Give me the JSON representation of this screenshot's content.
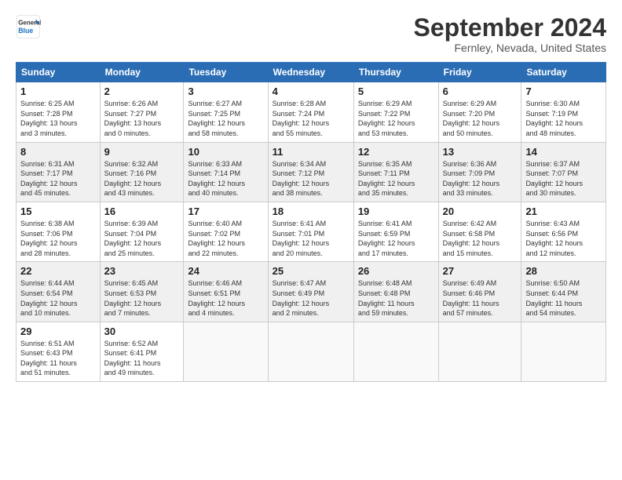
{
  "header": {
    "logo_line1": "General",
    "logo_line2": "Blue",
    "month": "September 2024",
    "location": "Fernley, Nevada, United States"
  },
  "weekdays": [
    "Sunday",
    "Monday",
    "Tuesday",
    "Wednesday",
    "Thursday",
    "Friday",
    "Saturday"
  ],
  "weeks": [
    [
      {
        "day": "1",
        "info": "Sunrise: 6:25 AM\nSunset: 7:28 PM\nDaylight: 13 hours\nand 3 minutes."
      },
      {
        "day": "2",
        "info": "Sunrise: 6:26 AM\nSunset: 7:27 PM\nDaylight: 13 hours\nand 0 minutes."
      },
      {
        "day": "3",
        "info": "Sunrise: 6:27 AM\nSunset: 7:25 PM\nDaylight: 12 hours\nand 58 minutes."
      },
      {
        "day": "4",
        "info": "Sunrise: 6:28 AM\nSunset: 7:24 PM\nDaylight: 12 hours\nand 55 minutes."
      },
      {
        "day": "5",
        "info": "Sunrise: 6:29 AM\nSunset: 7:22 PM\nDaylight: 12 hours\nand 53 minutes."
      },
      {
        "day": "6",
        "info": "Sunrise: 6:29 AM\nSunset: 7:20 PM\nDaylight: 12 hours\nand 50 minutes."
      },
      {
        "day": "7",
        "info": "Sunrise: 6:30 AM\nSunset: 7:19 PM\nDaylight: 12 hours\nand 48 minutes."
      }
    ],
    [
      {
        "day": "8",
        "info": "Sunrise: 6:31 AM\nSunset: 7:17 PM\nDaylight: 12 hours\nand 45 minutes."
      },
      {
        "day": "9",
        "info": "Sunrise: 6:32 AM\nSunset: 7:16 PM\nDaylight: 12 hours\nand 43 minutes."
      },
      {
        "day": "10",
        "info": "Sunrise: 6:33 AM\nSunset: 7:14 PM\nDaylight: 12 hours\nand 40 minutes."
      },
      {
        "day": "11",
        "info": "Sunrise: 6:34 AM\nSunset: 7:12 PM\nDaylight: 12 hours\nand 38 minutes."
      },
      {
        "day": "12",
        "info": "Sunrise: 6:35 AM\nSunset: 7:11 PM\nDaylight: 12 hours\nand 35 minutes."
      },
      {
        "day": "13",
        "info": "Sunrise: 6:36 AM\nSunset: 7:09 PM\nDaylight: 12 hours\nand 33 minutes."
      },
      {
        "day": "14",
        "info": "Sunrise: 6:37 AM\nSunset: 7:07 PM\nDaylight: 12 hours\nand 30 minutes."
      }
    ],
    [
      {
        "day": "15",
        "info": "Sunrise: 6:38 AM\nSunset: 7:06 PM\nDaylight: 12 hours\nand 28 minutes."
      },
      {
        "day": "16",
        "info": "Sunrise: 6:39 AM\nSunset: 7:04 PM\nDaylight: 12 hours\nand 25 minutes."
      },
      {
        "day": "17",
        "info": "Sunrise: 6:40 AM\nSunset: 7:02 PM\nDaylight: 12 hours\nand 22 minutes."
      },
      {
        "day": "18",
        "info": "Sunrise: 6:41 AM\nSunset: 7:01 PM\nDaylight: 12 hours\nand 20 minutes."
      },
      {
        "day": "19",
        "info": "Sunrise: 6:41 AM\nSunset: 6:59 PM\nDaylight: 12 hours\nand 17 minutes."
      },
      {
        "day": "20",
        "info": "Sunrise: 6:42 AM\nSunset: 6:58 PM\nDaylight: 12 hours\nand 15 minutes."
      },
      {
        "day": "21",
        "info": "Sunrise: 6:43 AM\nSunset: 6:56 PM\nDaylight: 12 hours\nand 12 minutes."
      }
    ],
    [
      {
        "day": "22",
        "info": "Sunrise: 6:44 AM\nSunset: 6:54 PM\nDaylight: 12 hours\nand 10 minutes."
      },
      {
        "day": "23",
        "info": "Sunrise: 6:45 AM\nSunset: 6:53 PM\nDaylight: 12 hours\nand 7 minutes."
      },
      {
        "day": "24",
        "info": "Sunrise: 6:46 AM\nSunset: 6:51 PM\nDaylight: 12 hours\nand 4 minutes."
      },
      {
        "day": "25",
        "info": "Sunrise: 6:47 AM\nSunset: 6:49 PM\nDaylight: 12 hours\nand 2 minutes."
      },
      {
        "day": "26",
        "info": "Sunrise: 6:48 AM\nSunset: 6:48 PM\nDaylight: 11 hours\nand 59 minutes."
      },
      {
        "day": "27",
        "info": "Sunrise: 6:49 AM\nSunset: 6:46 PM\nDaylight: 11 hours\nand 57 minutes."
      },
      {
        "day": "28",
        "info": "Sunrise: 6:50 AM\nSunset: 6:44 PM\nDaylight: 11 hours\nand 54 minutes."
      }
    ],
    [
      {
        "day": "29",
        "info": "Sunrise: 6:51 AM\nSunset: 6:43 PM\nDaylight: 11 hours\nand 51 minutes."
      },
      {
        "day": "30",
        "info": "Sunrise: 6:52 AM\nSunset: 6:41 PM\nDaylight: 11 hours\nand 49 minutes."
      },
      {
        "day": "",
        "info": ""
      },
      {
        "day": "",
        "info": ""
      },
      {
        "day": "",
        "info": ""
      },
      {
        "day": "",
        "info": ""
      },
      {
        "day": "",
        "info": ""
      }
    ]
  ]
}
